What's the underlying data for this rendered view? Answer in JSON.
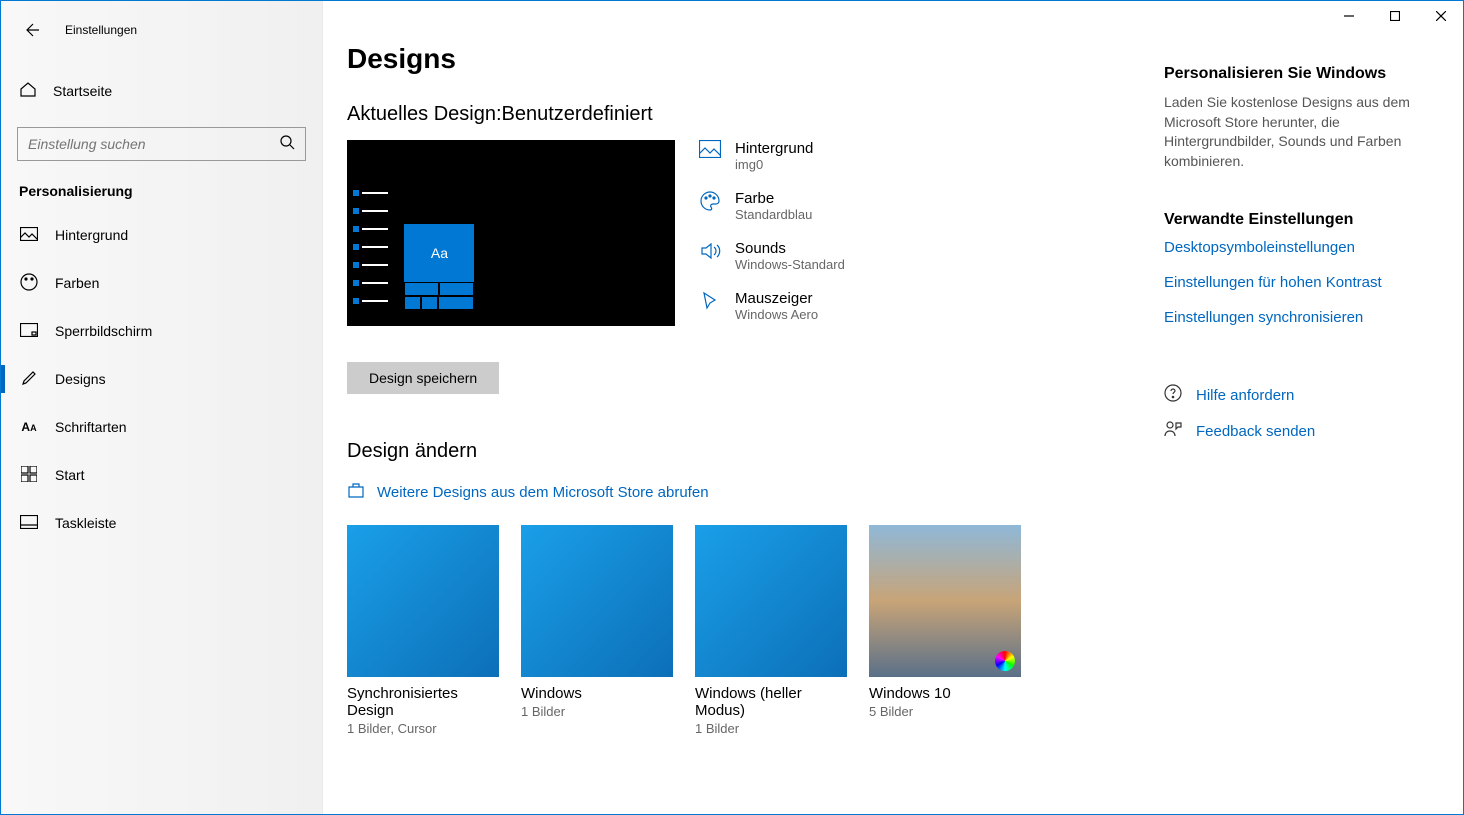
{
  "app_title": "Einstellungen",
  "home_label": "Startseite",
  "search_placeholder": "Einstellung suchen",
  "section_label": "Personalisierung",
  "nav": [
    {
      "label": "Hintergrund"
    },
    {
      "label": "Farben"
    },
    {
      "label": "Sperrbildschirm"
    },
    {
      "label": "Designs"
    },
    {
      "label": "Schriftarten"
    },
    {
      "label": "Start"
    },
    {
      "label": "Taskleiste"
    }
  ],
  "page_title": "Designs",
  "current_heading_prefix": "Aktuelles Design:",
  "current_heading_value": "Benutzerdefiniert",
  "preview_tile_text": "Aa",
  "props": {
    "background": {
      "title": "Hintergrund",
      "value": "img0"
    },
    "color": {
      "title": "Farbe",
      "value": "Standardblau"
    },
    "sounds": {
      "title": "Sounds",
      "value": "Windows-Standard"
    },
    "cursor": {
      "title": "Mauszeiger",
      "value": "Windows Aero"
    }
  },
  "save_button": "Design speichern",
  "change_heading": "Design ändern",
  "store_link": "Weitere Designs aus dem Microsoft Store abrufen",
  "themes": [
    {
      "name": "Synchronisiertes Design",
      "sub": "1 Bilder, Cursor"
    },
    {
      "name": "Windows",
      "sub": "1 Bilder"
    },
    {
      "name": "Windows (heller Modus)",
      "sub": "1 Bilder"
    },
    {
      "name": "Windows 10",
      "sub": "5 Bilder"
    }
  ],
  "aside": {
    "personalize_head": "Personalisieren Sie Windows",
    "personalize_text": "Laden Sie kostenlose Designs aus dem Microsoft Store herunter, die Hintergrundbilder, Sounds und Farben kombinieren.",
    "related_head": "Verwandte Einstellungen",
    "links": [
      "Desktopsymboleinstellungen",
      "Einstellungen für hohen Kontrast",
      "Einstellungen synchronisieren"
    ],
    "help": "Hilfe anfordern",
    "feedback": "Feedback senden"
  }
}
